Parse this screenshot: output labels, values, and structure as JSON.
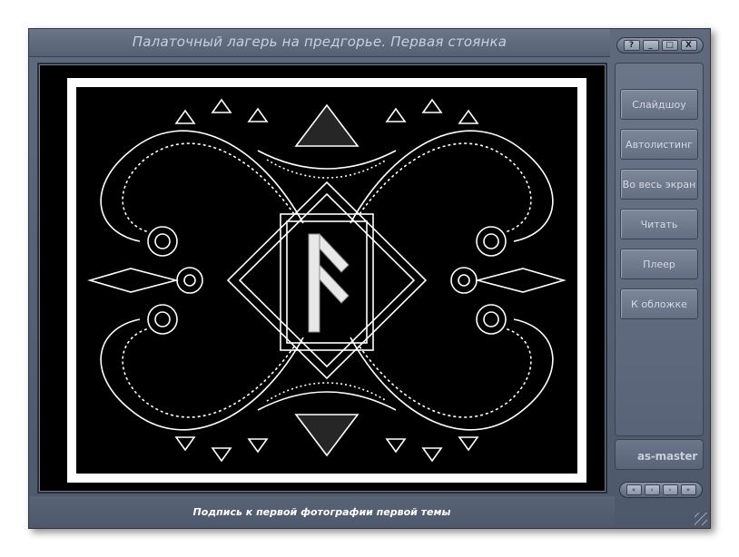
{
  "window": {
    "title": "Палаточный лагерь на предгорье. Первая стоянка",
    "controls": [
      "?",
      "_",
      "□",
      "X"
    ]
  },
  "viewer": {
    "image": "decorative-rune-ornament",
    "caption": "Подпись к первой фотографии первой темы"
  },
  "panel": {
    "buttons": [
      {
        "label": "Слайдшоу"
      },
      {
        "label": "Автолистинг"
      },
      {
        "label": "Во весь экран"
      },
      {
        "label": "Читать"
      },
      {
        "label": "Плеер"
      },
      {
        "label": "К обложке"
      }
    ],
    "brand": "as-master"
  },
  "navigation": [
    "«",
    "‹",
    "›",
    "»"
  ],
  "colors": {
    "window": "#566074",
    "accent_text": "#c9d0dc",
    "photo_bg": "#000000",
    "photo_frame": "#ffffff"
  }
}
